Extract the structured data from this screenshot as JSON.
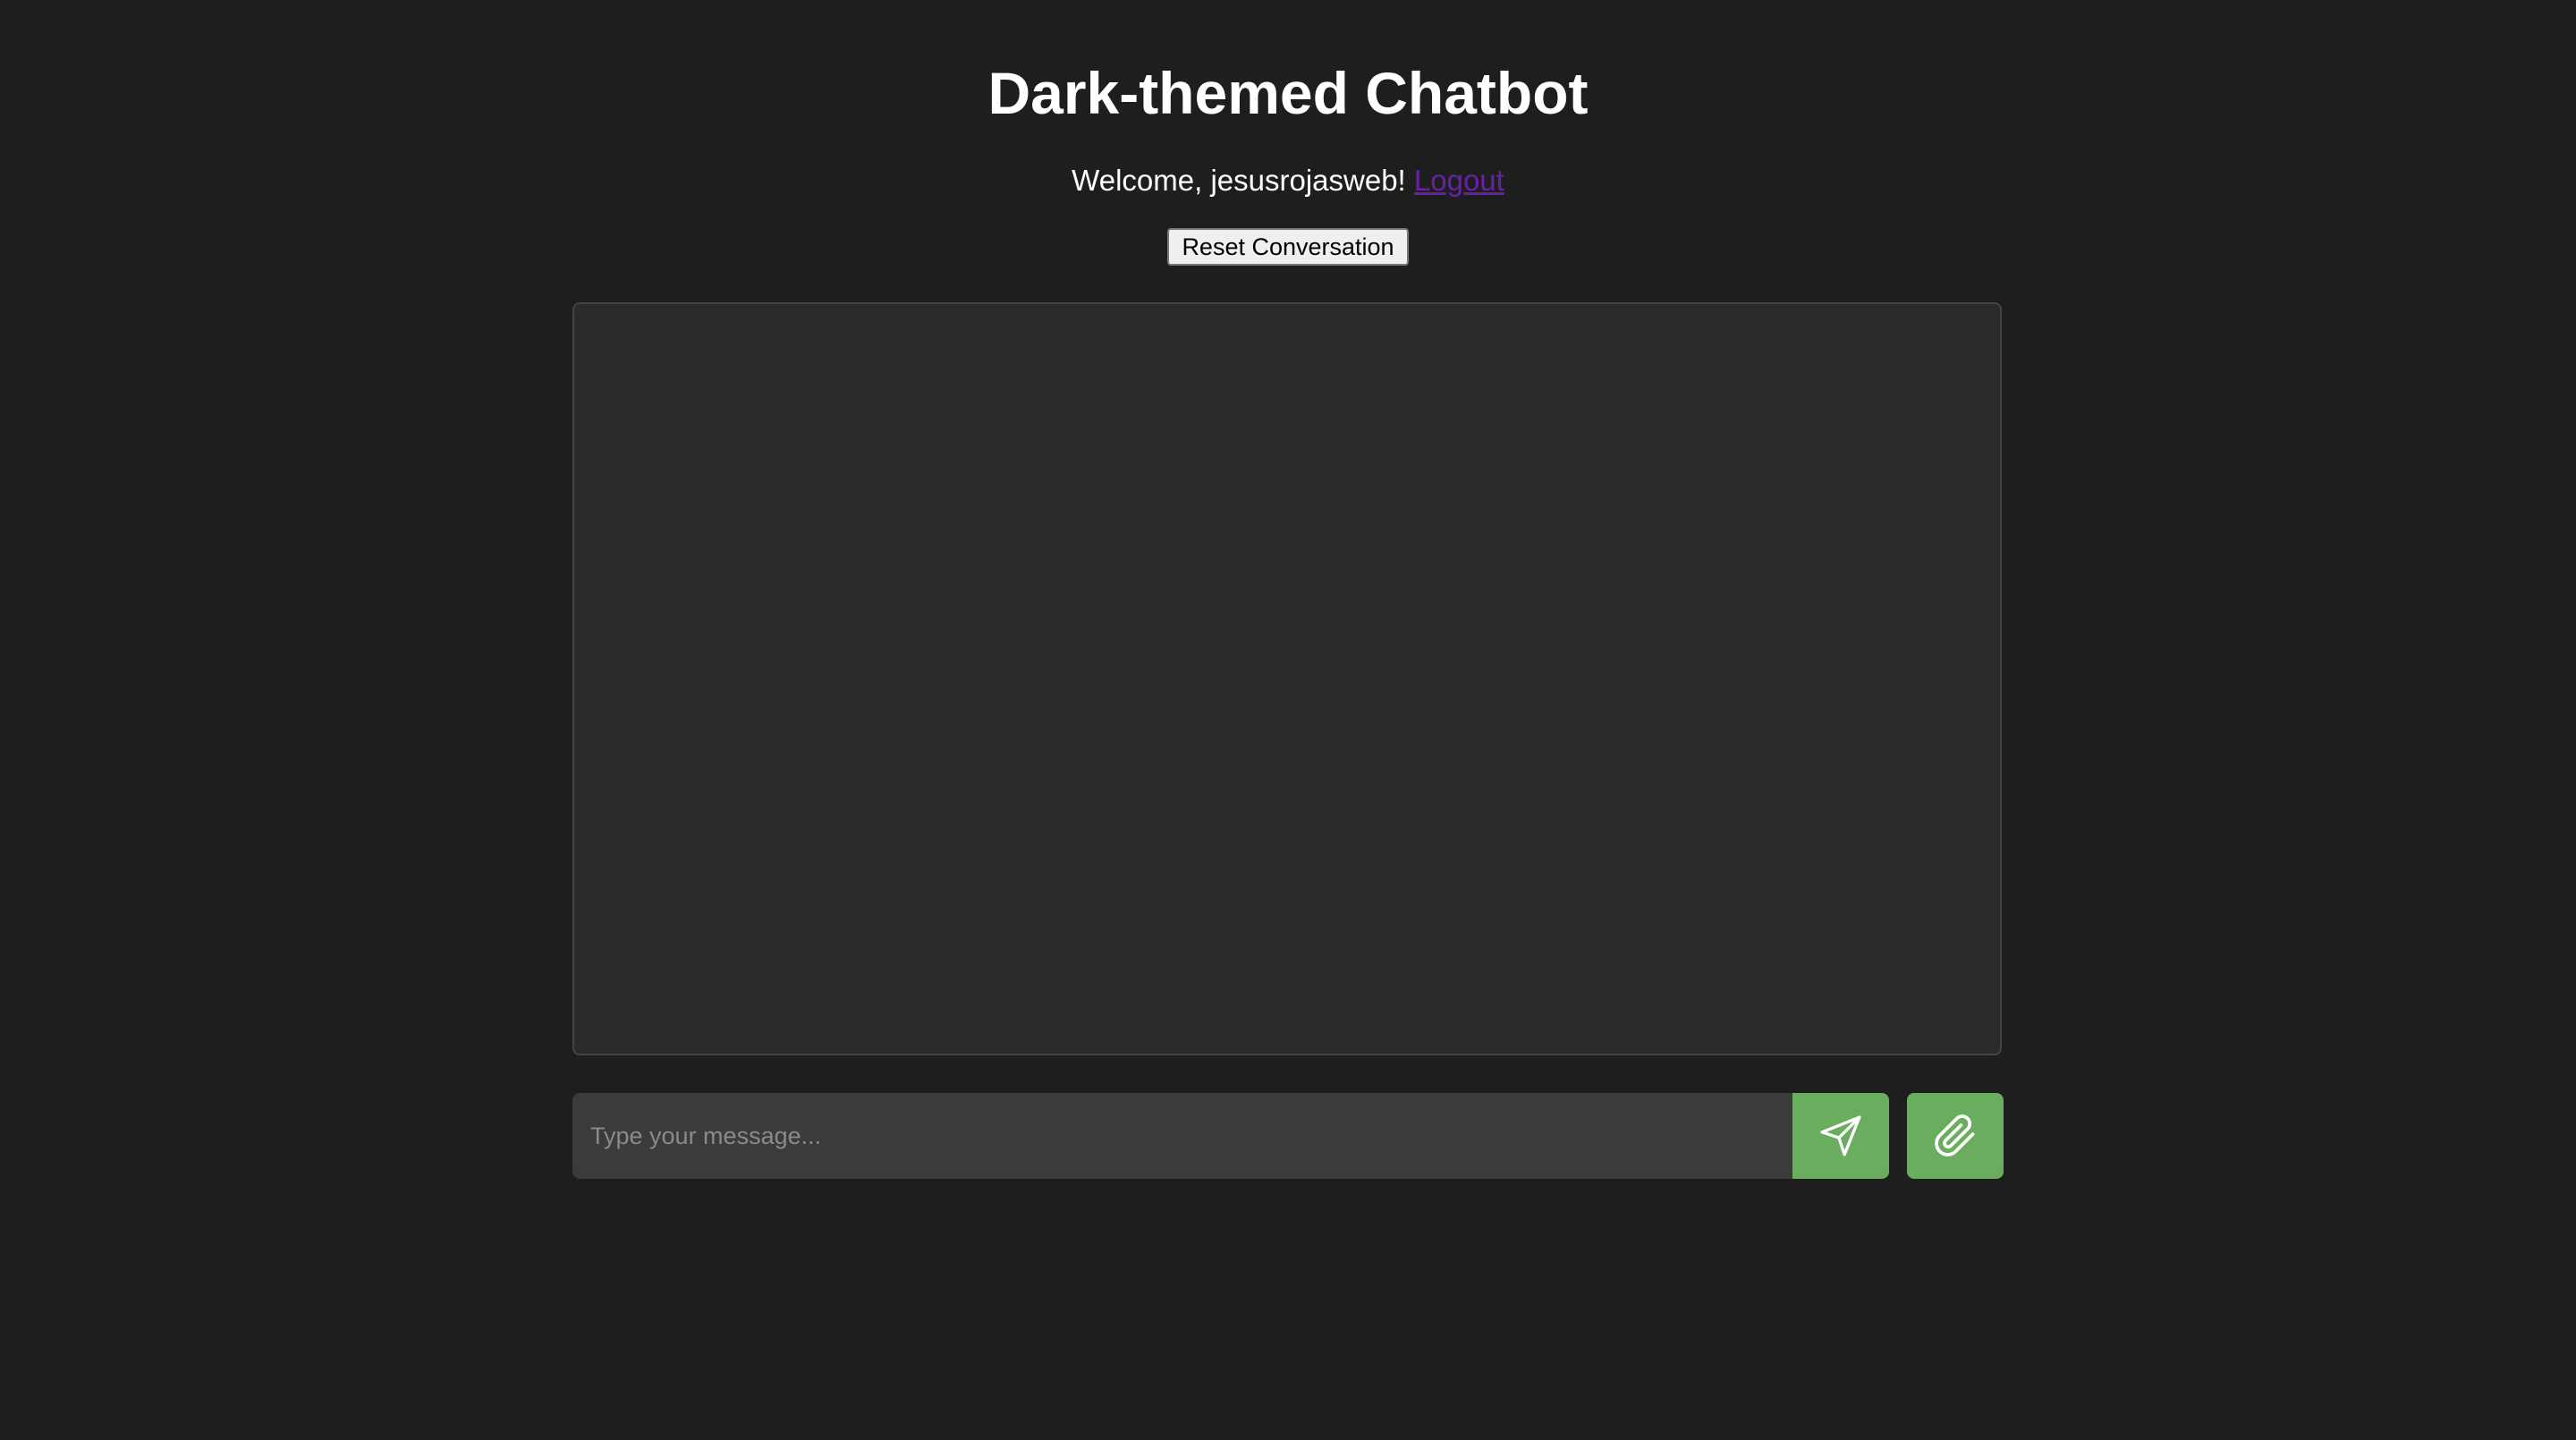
{
  "header": {
    "title": "Dark-themed Chatbot",
    "welcome_text": "Welcome, jesusrojasweb!",
    "logout_label": "Logout"
  },
  "controls": {
    "reset_label": "Reset Conversation"
  },
  "chat": {
    "messages": []
  },
  "composer": {
    "input_value": "",
    "input_placeholder": "Type your message...",
    "send_icon": "send-icon",
    "attach_icon": "paperclip-icon"
  },
  "colors": {
    "background": "#1e1e1e",
    "chat_area": "#2a2a2a",
    "input_bg": "#3b3b3b",
    "accent_green": "#6aad5e",
    "logout_link": "#6a1fa8"
  }
}
